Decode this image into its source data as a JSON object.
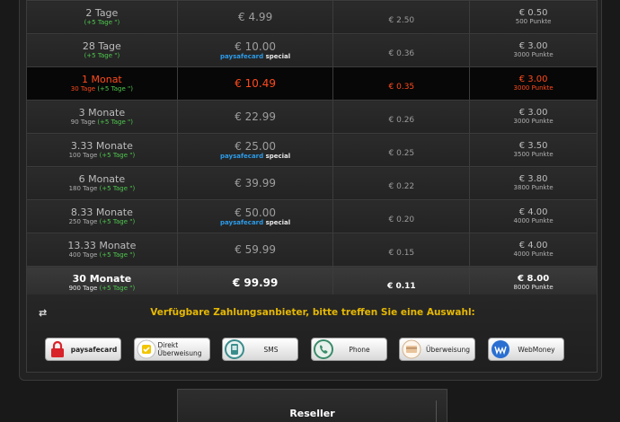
{
  "rows": [
    {
      "duration": "2 Tage",
      "days": "",
      "bonus": "(+5 Tage \")",
      "price": "€ 4.99",
      "special": false,
      "per_day": "€ 2.50",
      "points_price": "€ 0.50",
      "points": "500 Punkte"
    },
    {
      "duration": "28 Tage",
      "days": "",
      "bonus": "(+5 Tage \")",
      "price": "€ 10.00",
      "special": true,
      "per_day": "€ 0.36",
      "points_price": "€ 3.00",
      "points": "3000 Punkte"
    },
    {
      "duration": "1 Monat",
      "days": "30 Tage",
      "bonus": "(+5 Tage \")",
      "price": "€ 10.49",
      "special": false,
      "per_day": "€ 0.35",
      "points_price": "€ 3.00",
      "points": "3000 Punkte",
      "highlight": true
    },
    {
      "duration": "3 Monate",
      "days": "90 Tage",
      "bonus": "(+5 Tage \")",
      "price": "€ 22.99",
      "special": false,
      "per_day": "€ 0.26",
      "points_price": "€ 3.00",
      "points": "3000 Punkte"
    },
    {
      "duration": "3.33 Monate",
      "days": "100 Tage",
      "bonus": "(+5 Tage \")",
      "price": "€ 25.00",
      "special": true,
      "per_day": "€ 0.25",
      "points_price": "€ 3.50",
      "points": "3500 Punkte"
    },
    {
      "duration": "6 Monate",
      "days": "180 Tage",
      "bonus": "(+5 Tage \")",
      "price": "€ 39.99",
      "special": false,
      "per_day": "€ 0.22",
      "points_price": "€ 3.80",
      "points": "3800 Punkte"
    },
    {
      "duration": "8.33 Monate",
      "days": "250 Tage",
      "bonus": "(+5 Tage \")",
      "price": "€ 50.00",
      "special": true,
      "per_day": "€ 0.20",
      "points_price": "€ 4.00",
      "points": "4000 Punkte"
    },
    {
      "duration": "13.33 Monate",
      "days": "400 Tage",
      "bonus": "(+5 Tage \")",
      "price": "€ 59.99",
      "special": false,
      "per_day": "€ 0.15",
      "points_price": "€ 4.00",
      "points": "4000 Punkte"
    },
    {
      "duration": "30 Monate",
      "days": "900 Tage",
      "bonus": "(+5 Tage \")",
      "price": "€ 99.99",
      "special": false,
      "per_day": "€ 0.11",
      "points_price": "€ 8.00",
      "points": "8000 Punkte",
      "last": true
    }
  ],
  "special_label": {
    "brand": "paysafecard",
    "suffix": " special"
  },
  "payment": {
    "heading": "Verfügbare Zahlungsanbieter, bitte treffen Sie eine Auswahl:",
    "toggle_icon": "swap-arrows-icon",
    "methods": [
      {
        "label": "paysafecard",
        "icon": "padlock-icon",
        "color": "#d8232a"
      },
      {
        "label": "Direkt Überweisung",
        "icon": "sofort-icon",
        "color": "#f2c500"
      },
      {
        "label": "SMS",
        "icon": "sms-icon",
        "color": "#3a8c8c"
      },
      {
        "label": "Phone",
        "icon": "phone-icon",
        "color": "#3a8c6a"
      },
      {
        "label": "Überweisung",
        "icon": "bank-transfer-icon",
        "color": "#e8c39a"
      },
      {
        "label": "WebMoney",
        "icon": "webmoney-icon",
        "color": "#2a6fd1"
      }
    ]
  },
  "reseller": {
    "title": "Reseller"
  },
  "colors": {
    "highlight": "#ff4a1c",
    "heading": "#e6b800",
    "bonus": "#4fc84f",
    "paysafecard": "#2c9be8"
  }
}
